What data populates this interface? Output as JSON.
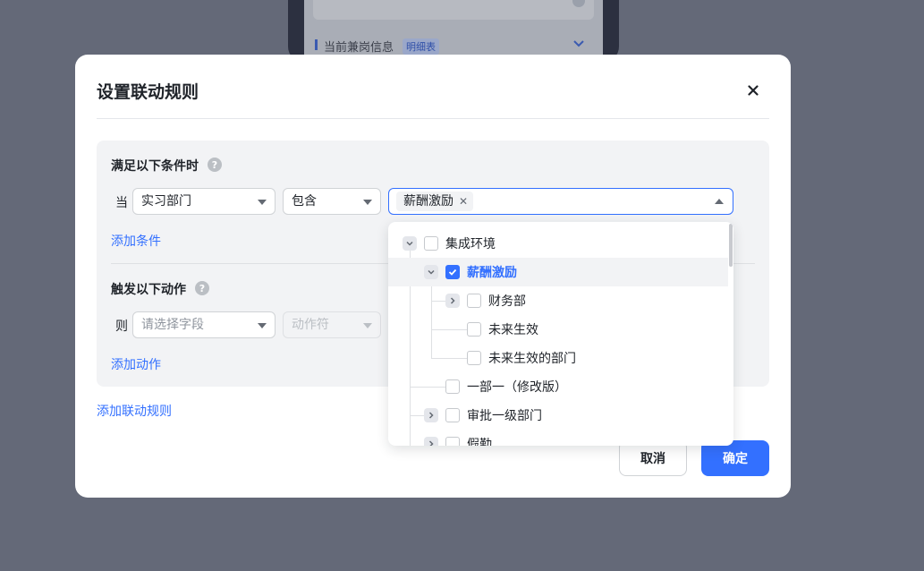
{
  "background": {
    "section_title": "当前兼岗信息",
    "section_tag": "明细表"
  },
  "modal": {
    "title": "设置联动规则",
    "conditions": {
      "title": "满足以下条件时",
      "help": "?",
      "row_prefix": "当",
      "field": "实习部门",
      "operator": "包含",
      "value_tag": "薪酬激励",
      "add_link": "添加条件"
    },
    "actions": {
      "title": "触发以下动作",
      "help": "?",
      "row_prefix": "则",
      "field_placeholder": "请选择字段",
      "operator_placeholder": "动作符",
      "add_link": "添加动作"
    },
    "add_rule_link": "添加联动规则",
    "cancel_label": "取消",
    "ok_label": "确定"
  },
  "tree": {
    "items": [
      {
        "label": "集成环境",
        "checked": false,
        "expanded": true
      },
      {
        "label": "薪酬激励",
        "checked": true,
        "expanded": true
      },
      {
        "label": "财务部",
        "checked": false,
        "expanded": false
      },
      {
        "label": "未来生效",
        "checked": false
      },
      {
        "label": "未来生效的部门",
        "checked": false
      },
      {
        "label": "一部一（修改版）",
        "checked": false
      },
      {
        "label": "审批一级部门",
        "checked": false,
        "expanded": false
      },
      {
        "label": "假勤",
        "checked": false,
        "expanded": false
      }
    ]
  },
  "colors": {
    "primary": "#3370ff",
    "overlay": "#646978"
  }
}
